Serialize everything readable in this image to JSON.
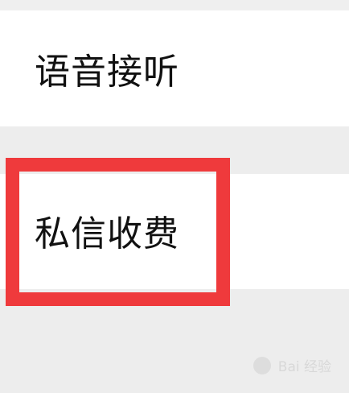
{
  "settings": {
    "items": [
      {
        "label": "语音接听"
      },
      {
        "label": "私信收费"
      }
    ]
  },
  "highlight": {
    "color": "#ef3a3c",
    "target": "私信收费"
  },
  "watermark": {
    "text": "Bai 经验"
  },
  "colors": {
    "background": "#ededed",
    "item_background": "#ffffff",
    "text": "#111111"
  }
}
